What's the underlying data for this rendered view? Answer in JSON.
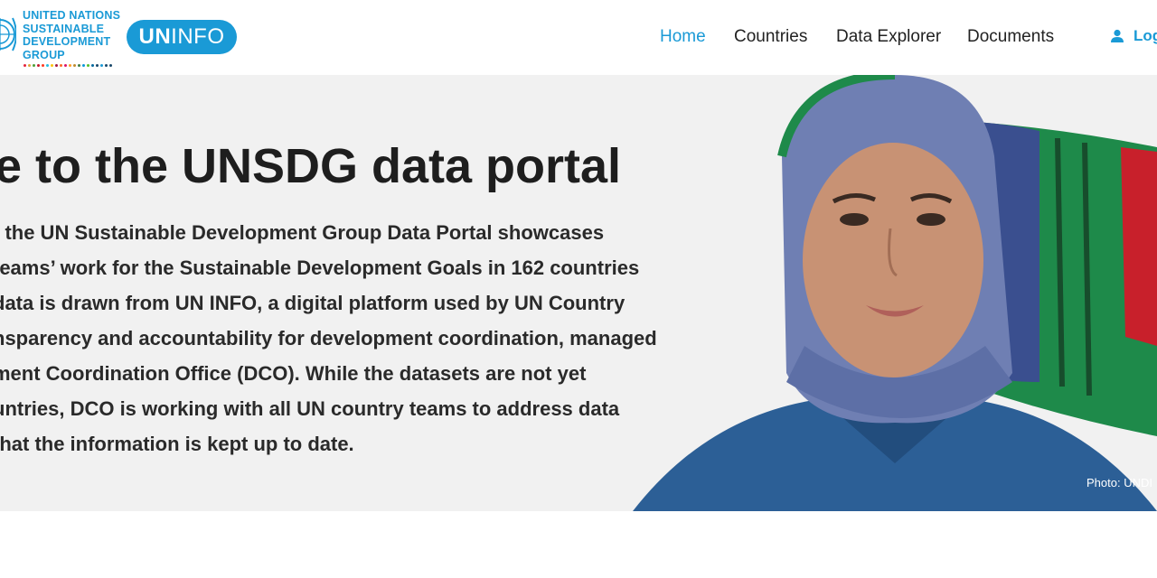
{
  "header": {
    "brand_lines": [
      "UNITED NATIONS",
      "SUSTAINABLE",
      "DEVELOPMENT",
      "GROUP"
    ],
    "uninfo_bold": "UN",
    "uninfo_light": "INFO",
    "nav": [
      "Home",
      "Countries",
      "Data Explorer",
      "Documents"
    ],
    "login_label": "Log",
    "colors": {
      "accent": "#1a9ad6"
    }
  },
  "hero": {
    "title": "e to the UNSDG data portal",
    "body_lines": [
      "f the UN Sustainable Development Group Data Portal showcases",
      "teams’ work for the Sustainable Development Goals in 162 countries",
      "data is drawn from UN INFO, a digital platform used by UN Country",
      "nsparency and accountability for development coordination, managed",
      "ment Coordination Office (DCO). While the datasets are not yet",
      "untries, DCO is working with all UN country teams to address data",
      "that the information is kept up to date."
    ],
    "photo_credit": "Photo: UNDI"
  }
}
